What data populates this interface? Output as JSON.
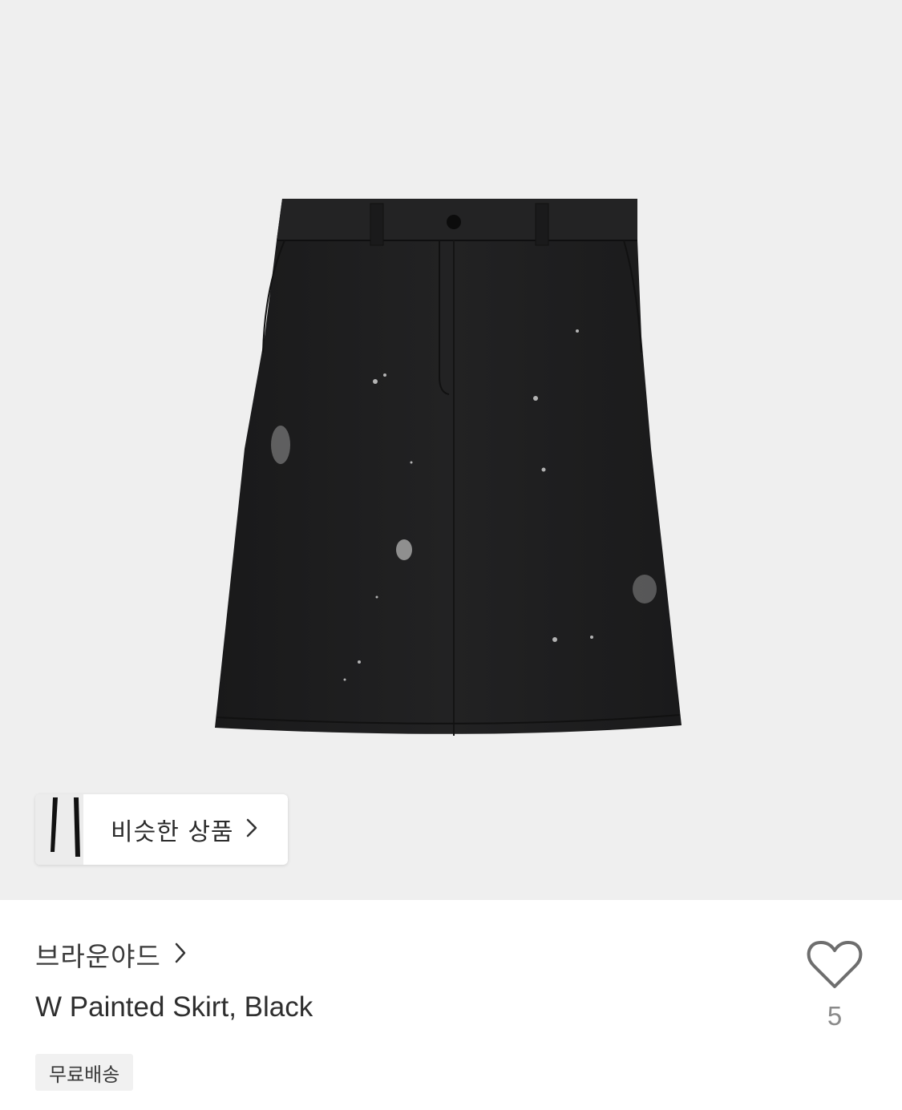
{
  "product": {
    "image_alt": "W Painted Skirt, Black product photo",
    "similar_products_label": "비슷한 상품",
    "brand": "브라운야드",
    "title": "W Painted Skirt, Black",
    "badge": "무료배송",
    "like_count": "5"
  },
  "icons": {
    "chevron": "chevron-right-icon",
    "heart": "heart-outline-icon"
  },
  "colors": {
    "image_background": "#efefef",
    "skirt": "#1e1e1f",
    "badge_background": "#f1f1f1",
    "like_count": "#8a8a8a"
  }
}
